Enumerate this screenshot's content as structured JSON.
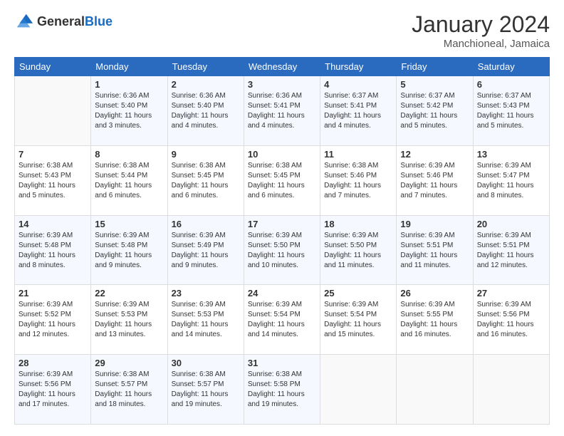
{
  "header": {
    "logo": {
      "general": "General",
      "blue": "Blue"
    },
    "title": "January 2024",
    "location": "Manchioneal, Jamaica"
  },
  "calendar": {
    "headers": [
      "Sunday",
      "Monday",
      "Tuesday",
      "Wednesday",
      "Thursday",
      "Friday",
      "Saturday"
    ],
    "weeks": [
      [
        {
          "day": "",
          "info": ""
        },
        {
          "day": "1",
          "info": "Sunrise: 6:36 AM\nSunset: 5:40 PM\nDaylight: 11 hours\nand 3 minutes."
        },
        {
          "day": "2",
          "info": "Sunrise: 6:36 AM\nSunset: 5:40 PM\nDaylight: 11 hours\nand 4 minutes."
        },
        {
          "day": "3",
          "info": "Sunrise: 6:36 AM\nSunset: 5:41 PM\nDaylight: 11 hours\nand 4 minutes."
        },
        {
          "day": "4",
          "info": "Sunrise: 6:37 AM\nSunset: 5:41 PM\nDaylight: 11 hours\nand 4 minutes."
        },
        {
          "day": "5",
          "info": "Sunrise: 6:37 AM\nSunset: 5:42 PM\nDaylight: 11 hours\nand 5 minutes."
        },
        {
          "day": "6",
          "info": "Sunrise: 6:37 AM\nSunset: 5:43 PM\nDaylight: 11 hours\nand 5 minutes."
        }
      ],
      [
        {
          "day": "7",
          "info": "Sunrise: 6:38 AM\nSunset: 5:43 PM\nDaylight: 11 hours\nand 5 minutes."
        },
        {
          "day": "8",
          "info": "Sunrise: 6:38 AM\nSunset: 5:44 PM\nDaylight: 11 hours\nand 6 minutes."
        },
        {
          "day": "9",
          "info": "Sunrise: 6:38 AM\nSunset: 5:45 PM\nDaylight: 11 hours\nand 6 minutes."
        },
        {
          "day": "10",
          "info": "Sunrise: 6:38 AM\nSunset: 5:45 PM\nDaylight: 11 hours\nand 6 minutes."
        },
        {
          "day": "11",
          "info": "Sunrise: 6:38 AM\nSunset: 5:46 PM\nDaylight: 11 hours\nand 7 minutes."
        },
        {
          "day": "12",
          "info": "Sunrise: 6:39 AM\nSunset: 5:46 PM\nDaylight: 11 hours\nand 7 minutes."
        },
        {
          "day": "13",
          "info": "Sunrise: 6:39 AM\nSunset: 5:47 PM\nDaylight: 11 hours\nand 8 minutes."
        }
      ],
      [
        {
          "day": "14",
          "info": "Sunrise: 6:39 AM\nSunset: 5:48 PM\nDaylight: 11 hours\nand 8 minutes."
        },
        {
          "day": "15",
          "info": "Sunrise: 6:39 AM\nSunset: 5:48 PM\nDaylight: 11 hours\nand 9 minutes."
        },
        {
          "day": "16",
          "info": "Sunrise: 6:39 AM\nSunset: 5:49 PM\nDaylight: 11 hours\nand 9 minutes."
        },
        {
          "day": "17",
          "info": "Sunrise: 6:39 AM\nSunset: 5:50 PM\nDaylight: 11 hours\nand 10 minutes."
        },
        {
          "day": "18",
          "info": "Sunrise: 6:39 AM\nSunset: 5:50 PM\nDaylight: 11 hours\nand 11 minutes."
        },
        {
          "day": "19",
          "info": "Sunrise: 6:39 AM\nSunset: 5:51 PM\nDaylight: 11 hours\nand 11 minutes."
        },
        {
          "day": "20",
          "info": "Sunrise: 6:39 AM\nSunset: 5:51 PM\nDaylight: 11 hours\nand 12 minutes."
        }
      ],
      [
        {
          "day": "21",
          "info": "Sunrise: 6:39 AM\nSunset: 5:52 PM\nDaylight: 11 hours\nand 12 minutes."
        },
        {
          "day": "22",
          "info": "Sunrise: 6:39 AM\nSunset: 5:53 PM\nDaylight: 11 hours\nand 13 minutes."
        },
        {
          "day": "23",
          "info": "Sunrise: 6:39 AM\nSunset: 5:53 PM\nDaylight: 11 hours\nand 14 minutes."
        },
        {
          "day": "24",
          "info": "Sunrise: 6:39 AM\nSunset: 5:54 PM\nDaylight: 11 hours\nand 14 minutes."
        },
        {
          "day": "25",
          "info": "Sunrise: 6:39 AM\nSunset: 5:54 PM\nDaylight: 11 hours\nand 15 minutes."
        },
        {
          "day": "26",
          "info": "Sunrise: 6:39 AM\nSunset: 5:55 PM\nDaylight: 11 hours\nand 16 minutes."
        },
        {
          "day": "27",
          "info": "Sunrise: 6:39 AM\nSunset: 5:56 PM\nDaylight: 11 hours\nand 16 minutes."
        }
      ],
      [
        {
          "day": "28",
          "info": "Sunrise: 6:39 AM\nSunset: 5:56 PM\nDaylight: 11 hours\nand 17 minutes."
        },
        {
          "day": "29",
          "info": "Sunrise: 6:38 AM\nSunset: 5:57 PM\nDaylight: 11 hours\nand 18 minutes."
        },
        {
          "day": "30",
          "info": "Sunrise: 6:38 AM\nSunset: 5:57 PM\nDaylight: 11 hours\nand 19 minutes."
        },
        {
          "day": "31",
          "info": "Sunrise: 6:38 AM\nSunset: 5:58 PM\nDaylight: 11 hours\nand 19 minutes."
        },
        {
          "day": "",
          "info": ""
        },
        {
          "day": "",
          "info": ""
        },
        {
          "day": "",
          "info": ""
        }
      ]
    ]
  }
}
